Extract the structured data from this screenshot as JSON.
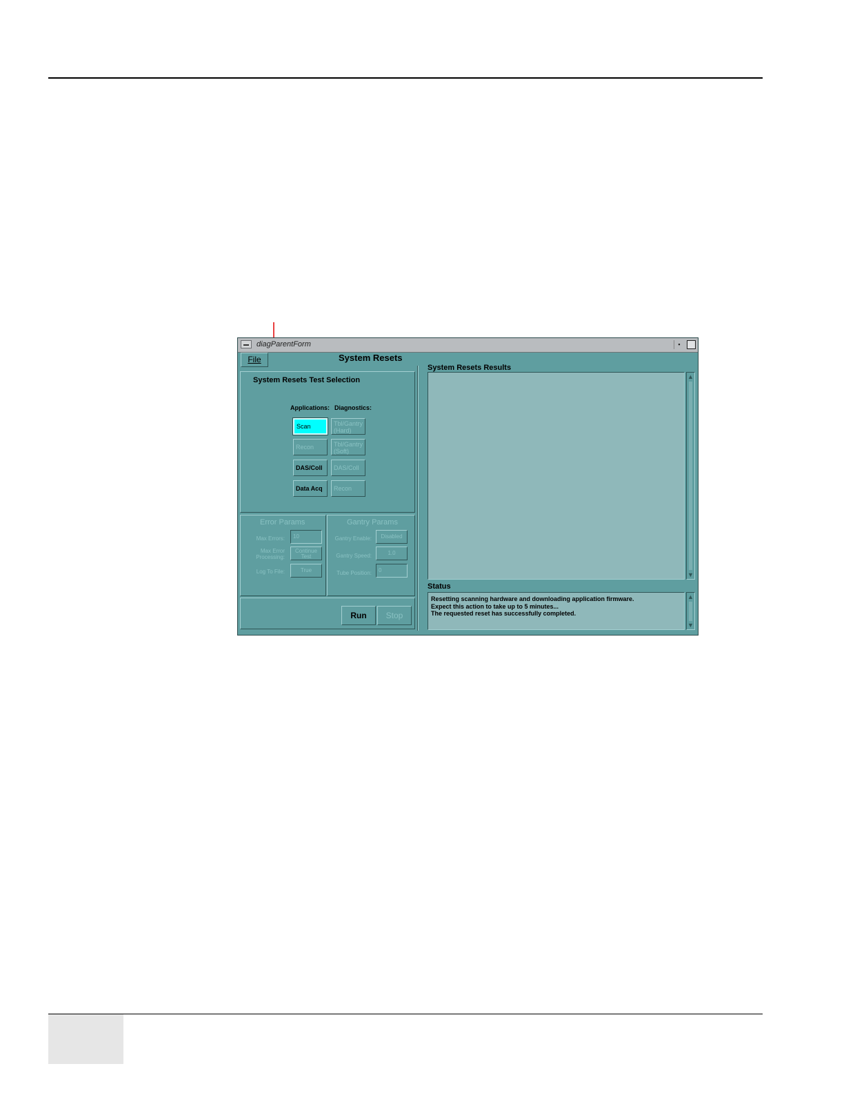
{
  "window": {
    "title": "diagParentForm",
    "form_title": "System Resets"
  },
  "menu": {
    "file_label": "File"
  },
  "test_selection": {
    "title": "System Resets Test Selection",
    "applications_header": "Applications:",
    "diagnostics_header": "Diagnostics:",
    "applications": [
      {
        "label": "Scan",
        "state": "selected"
      },
      {
        "label": "Recon",
        "state": "disabled"
      },
      {
        "label": "DAS/Coll",
        "state": "enabled"
      },
      {
        "label": "Data Acq",
        "state": "enabled"
      }
    ],
    "diagnostics": [
      {
        "label": "Tbl/Gantry (Hard)",
        "line1": "Tbl/Gantry",
        "line2": "(Hard)",
        "state": "disabled"
      },
      {
        "label": "Tbl/Gantry (Soft)",
        "line1": "Tbl/Gantry",
        "line2": "(Soft)",
        "state": "disabled"
      },
      {
        "label": "DAS/Coll",
        "state": "disabled"
      },
      {
        "label": "Recon",
        "state": "disabled"
      }
    ]
  },
  "error_params": {
    "title": "Error Params",
    "max_errors_label": "Max Errors:",
    "max_errors_value": "10",
    "max_error_processing_label_1": "Max Error",
    "max_error_processing_label_2": "Processing:",
    "max_error_processing_value_1": "Continue",
    "max_error_processing_value_2": "Test",
    "log_to_file_label": "Log To File:",
    "log_to_file_value": "True"
  },
  "gantry_params": {
    "title": "Gantry Params",
    "gantry_enable_label": "Gantry Enable:",
    "gantry_enable_value": "Disabled",
    "gantry_speed_label": "Gantry Speed:",
    "gantry_speed_value": "1.0",
    "tube_position_label": "Tube Position:",
    "tube_position_value": "0"
  },
  "actions": {
    "run_label": "Run",
    "stop_label": "Stop"
  },
  "results": {
    "title": "System Resets Results"
  },
  "status": {
    "title": "Status",
    "lines": [
      "Resetting scanning hardware and downloading application firmware.",
      "Expect this action to take up to 5 minutes...",
      "The requested reset has successfully completed."
    ]
  },
  "colors": {
    "window_bg": "#5f9ea0",
    "selected_button": "#00ffff",
    "text_area_bg": "#8fb8ba",
    "annotation_callout": "#e00000"
  }
}
